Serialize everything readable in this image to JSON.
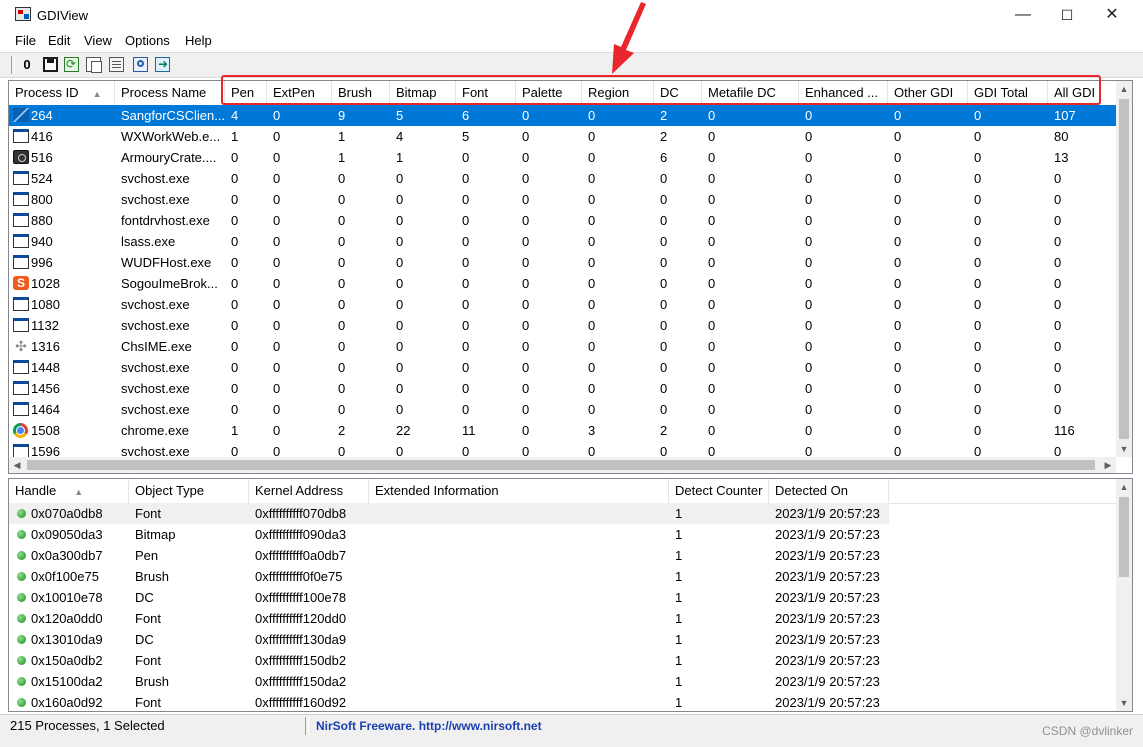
{
  "window": {
    "title": "GDIView",
    "minimize": "—",
    "maximize": "☐",
    "close": "✕"
  },
  "menu": [
    "File",
    "Edit",
    "View",
    "Options",
    "Help"
  ],
  "toolbar": {
    "zero_button": "0"
  },
  "process_list": {
    "columns": [
      "Process ID",
      "Process Name",
      "Pen",
      "ExtPen",
      "Brush",
      "Bitmap",
      "Font",
      "Palette",
      "Region",
      "DC",
      "Metafile DC",
      "Enhanced ...",
      "Other GDI",
      "GDI Total",
      "All GDI"
    ],
    "sort_indicator": "▲",
    "rows": [
      {
        "icon": "sangfor",
        "cells": [
          "264",
          "SangforCSClien...",
          "4",
          "0",
          "9",
          "5",
          "6",
          "0",
          "0",
          "2",
          "0",
          "0",
          "0",
          "0",
          "107"
        ],
        "selected": true
      },
      {
        "icon": "window",
        "cells": [
          "416",
          "WXWorkWeb.e...",
          "1",
          "0",
          "1",
          "4",
          "5",
          "0",
          "0",
          "2",
          "0",
          "0",
          "0",
          "0",
          "80"
        ]
      },
      {
        "icon": "armoury",
        "cells": [
          "516",
          "ArmouryCrate....",
          "0",
          "0",
          "1",
          "1",
          "0",
          "0",
          "0",
          "6",
          "0",
          "0",
          "0",
          "0",
          "13"
        ]
      },
      {
        "icon": "window",
        "cells": [
          "524",
          "svchost.exe",
          "0",
          "0",
          "0",
          "0",
          "0",
          "0",
          "0",
          "0",
          "0",
          "0",
          "0",
          "0",
          "0"
        ]
      },
      {
        "icon": "window",
        "cells": [
          "800",
          "svchost.exe",
          "0",
          "0",
          "0",
          "0",
          "0",
          "0",
          "0",
          "0",
          "0",
          "0",
          "0",
          "0",
          "0"
        ]
      },
      {
        "icon": "window",
        "cells": [
          "880",
          "fontdrvhost.exe",
          "0",
          "0",
          "0",
          "0",
          "0",
          "0",
          "0",
          "0",
          "0",
          "0",
          "0",
          "0",
          "0"
        ]
      },
      {
        "icon": "window",
        "cells": [
          "940",
          "lsass.exe",
          "0",
          "0",
          "0",
          "0",
          "0",
          "0",
          "0",
          "0",
          "0",
          "0",
          "0",
          "0",
          "0"
        ]
      },
      {
        "icon": "window",
        "cells": [
          "996",
          "WUDFHost.exe",
          "0",
          "0",
          "0",
          "0",
          "0",
          "0",
          "0",
          "0",
          "0",
          "0",
          "0",
          "0",
          "0"
        ]
      },
      {
        "icon": "sogou",
        "cells": [
          "1028",
          "SogouImeBrok...",
          "0",
          "0",
          "0",
          "0",
          "0",
          "0",
          "0",
          "0",
          "0",
          "0",
          "0",
          "0",
          "0"
        ]
      },
      {
        "icon": "window",
        "cells": [
          "1080",
          "svchost.exe",
          "0",
          "0",
          "0",
          "0",
          "0",
          "0",
          "0",
          "0",
          "0",
          "0",
          "0",
          "0",
          "0"
        ]
      },
      {
        "icon": "window",
        "cells": [
          "1132",
          "svchost.exe",
          "0",
          "0",
          "0",
          "0",
          "0",
          "0",
          "0",
          "0",
          "0",
          "0",
          "0",
          "0",
          "0"
        ]
      },
      {
        "icon": "ime",
        "cells": [
          "1316",
          "ChsIME.exe",
          "0",
          "0",
          "0",
          "0",
          "0",
          "0",
          "0",
          "0",
          "0",
          "0",
          "0",
          "0",
          "0"
        ]
      },
      {
        "icon": "window",
        "cells": [
          "1448",
          "svchost.exe",
          "0",
          "0",
          "0",
          "0",
          "0",
          "0",
          "0",
          "0",
          "0",
          "0",
          "0",
          "0",
          "0"
        ]
      },
      {
        "icon": "window",
        "cells": [
          "1456",
          "svchost.exe",
          "0",
          "0",
          "0",
          "0",
          "0",
          "0",
          "0",
          "0",
          "0",
          "0",
          "0",
          "0",
          "0"
        ]
      },
      {
        "icon": "window",
        "cells": [
          "1464",
          "svchost.exe",
          "0",
          "0",
          "0",
          "0",
          "0",
          "0",
          "0",
          "0",
          "0",
          "0",
          "0",
          "0",
          "0"
        ]
      },
      {
        "icon": "chrome",
        "cells": [
          "1508",
          "chrome.exe",
          "1",
          "0",
          "2",
          "22",
          "11",
          "0",
          "3",
          "2",
          "0",
          "0",
          "0",
          "0",
          "116"
        ]
      },
      {
        "icon": "window",
        "cells": [
          "1596",
          "svchost.exe",
          "0",
          "0",
          "0",
          "0",
          "0",
          "0",
          "0",
          "0",
          "0",
          "0",
          "0",
          "0",
          "0"
        ]
      }
    ]
  },
  "handle_list": {
    "columns": [
      "Handle",
      "Object Type",
      "Kernel Address",
      "Extended Information",
      "Detect Counter",
      "Detected On"
    ],
    "rows": [
      [
        "0x070a0db8",
        "Font",
        "0xffffffffff070db8",
        "",
        "1",
        "2023/1/9 20:57:23"
      ],
      [
        "0x09050da3",
        "Bitmap",
        "0xffffffffff090da3",
        "",
        "1",
        "2023/1/9 20:57:23"
      ],
      [
        "0x0a300db7",
        "Pen",
        "0xffffffffff0a0db7",
        "",
        "1",
        "2023/1/9 20:57:23"
      ],
      [
        "0x0f100e75",
        "Brush",
        "0xffffffffff0f0e75",
        "",
        "1",
        "2023/1/9 20:57:23"
      ],
      [
        "0x10010e78",
        "DC",
        "0xffffffffff100e78",
        "",
        "1",
        "2023/1/9 20:57:23"
      ],
      [
        "0x120a0dd0",
        "Font",
        "0xffffffffff120dd0",
        "",
        "1",
        "2023/1/9 20:57:23"
      ],
      [
        "0x13010da9",
        "DC",
        "0xffffffffff130da9",
        "",
        "1",
        "2023/1/9 20:57:23"
      ],
      [
        "0x150a0db2",
        "Font",
        "0xffffffffff150db2",
        "",
        "1",
        "2023/1/9 20:57:23"
      ],
      [
        "0x15100da2",
        "Brush",
        "0xffffffffff150da2",
        "",
        "1",
        "2023/1/9 20:57:23"
      ],
      [
        "0x160a0d92",
        "Font",
        "0xffffffffff160d92",
        "",
        "1",
        "2023/1/9 20:57:23"
      ]
    ]
  },
  "status": {
    "count": "215 Processes, 1 Selected",
    "credit": "NirSoft Freeware.  http://www.nirsoft.net"
  },
  "watermark": "CSDN @dvlinker",
  "colors": {
    "selection": "#0078d7",
    "annotation": "#e8262c",
    "credit": "#1a3fb0"
  }
}
